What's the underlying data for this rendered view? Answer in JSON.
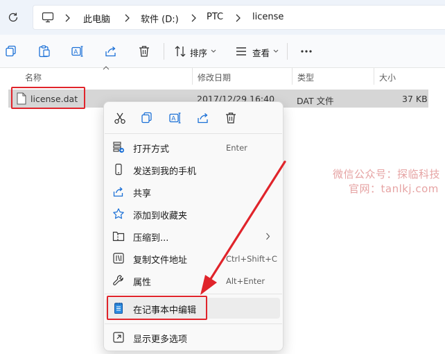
{
  "address_bar": {
    "breadcrumbs": [
      "此电脑",
      "软件 (D:)",
      "PTC",
      "license"
    ]
  },
  "toolbar": {
    "sort_label": "排序",
    "view_label": "查看"
  },
  "columns": {
    "name": "名称",
    "modified": "修改日期",
    "type": "类型",
    "size": "大小"
  },
  "file": {
    "name": "license.dat",
    "modified": "2017/12/29 16:40",
    "type": "DAT 文件",
    "size": "37 KB"
  },
  "context_menu": {
    "quick_actions": [
      "cut-icon",
      "copy-icon",
      "rename-icon",
      "share-icon",
      "delete-icon"
    ],
    "items": [
      {
        "label": "打开方式",
        "accel": "Enter",
        "icon": "open-with-icon"
      },
      {
        "label": "发送到我的手机",
        "accel": "",
        "icon": "phone-icon"
      },
      {
        "label": "共享",
        "accel": "",
        "icon": "share-icon"
      },
      {
        "label": "添加到收藏夹",
        "accel": "",
        "icon": "star-icon"
      },
      {
        "label": "压缩到...",
        "accel": "",
        "icon": "zip-folder-icon"
      },
      {
        "label": "复制文件地址",
        "accel": "Ctrl+Shift+C",
        "icon": "copy-path-icon"
      },
      {
        "label": "属性",
        "accel": "Alt+Enter",
        "icon": "wrench-icon"
      },
      {
        "label": "在记事本中编辑",
        "accel": "",
        "icon": "notepad-icon"
      },
      {
        "label": "显示更多选项",
        "accel": "",
        "icon": "more-options-icon"
      }
    ]
  },
  "watermark": {
    "line1": "微信公众号：探临科技",
    "line2": "官网：tanlkj.com"
  },
  "colors": {
    "annotation_red": "#e0242b",
    "selected_row": "#d6d6d6",
    "accent_blue": "#1a6fd6"
  }
}
